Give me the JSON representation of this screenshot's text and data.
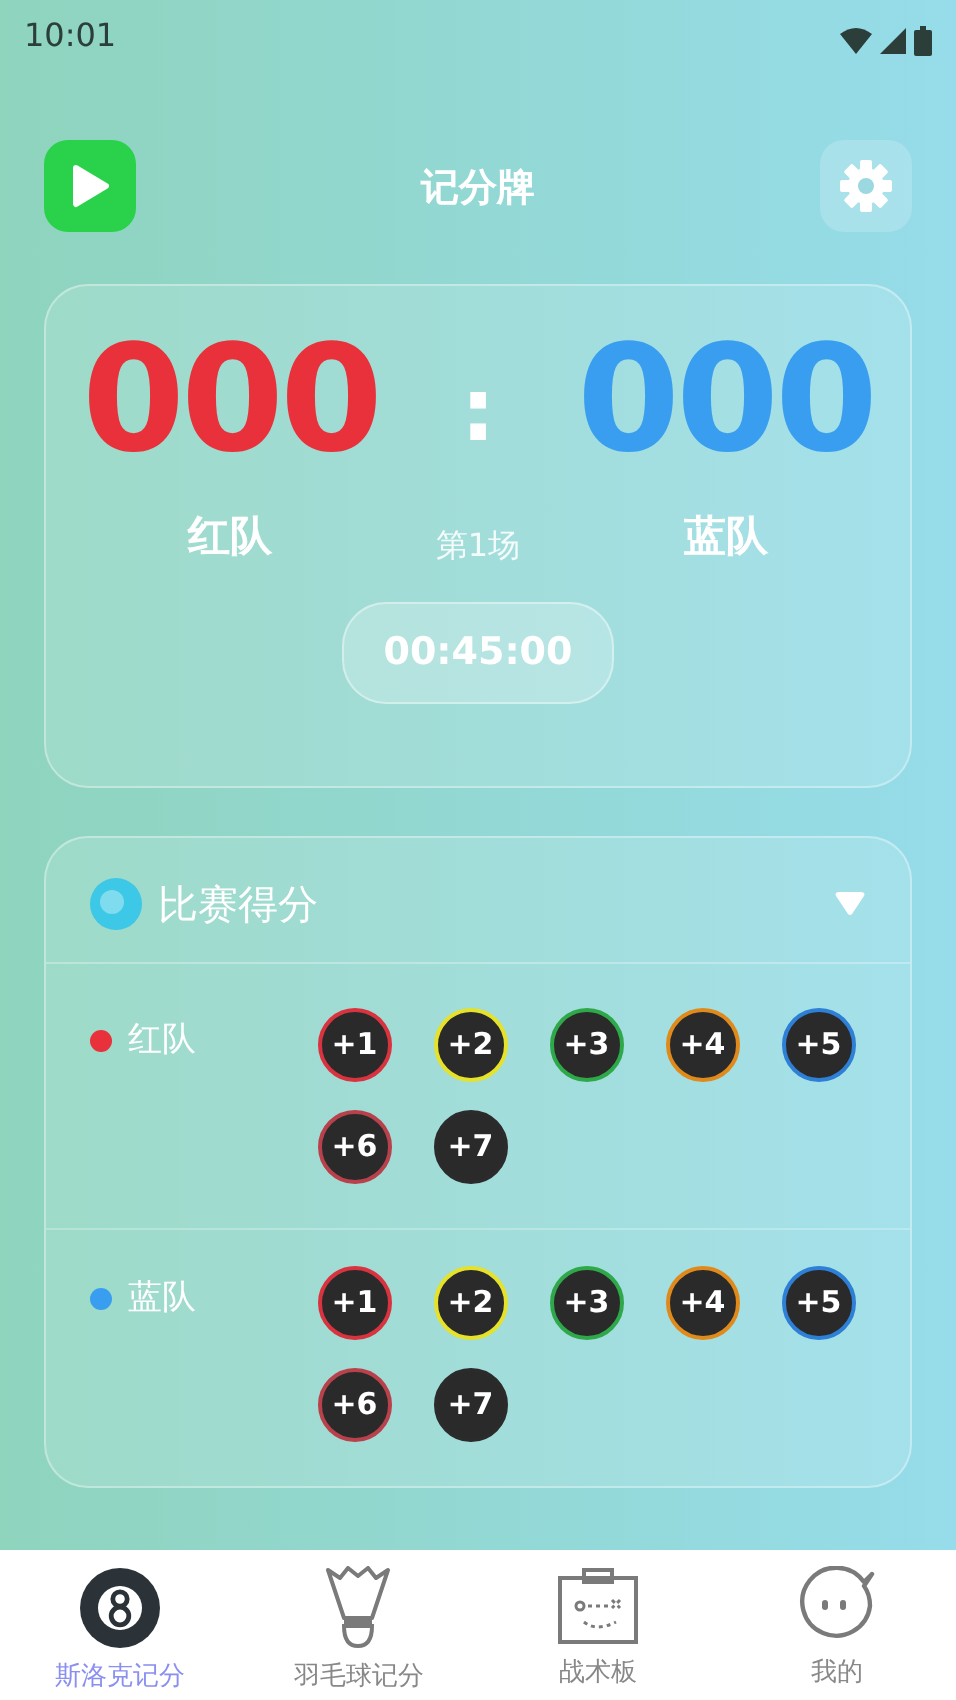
{
  "status_bar": {
    "time": "10:01"
  },
  "header": {
    "title": "记分牌"
  },
  "scoreboard": {
    "left": {
      "score": "000",
      "name": "红队",
      "color": "#e8313a"
    },
    "separator": ":",
    "right": {
      "score": "000",
      "name": "蓝队",
      "color": "#3a9ef0"
    },
    "round": "第1场",
    "timer": "00:45:00"
  },
  "scoring": {
    "title": "比赛得分",
    "expanded": true,
    "teams": [
      {
        "name": "红队",
        "color": "#e8313a",
        "buttons": [
          {
            "label": "+1",
            "color": "#d9333f"
          },
          {
            "label": "+2",
            "color": "#e6e22a"
          },
          {
            "label": "+3",
            "color": "#2fa84a"
          },
          {
            "label": "+4",
            "color": "#e08a1c"
          },
          {
            "label": "+5",
            "color": "#2e7fd6"
          },
          {
            "label": "+6",
            "color": "#b8414c"
          },
          {
            "label": "+7",
            "color": "#2b2b2b"
          }
        ]
      },
      {
        "name": "蓝队",
        "color": "#3a9ef0",
        "buttons": [
          {
            "label": "+1",
            "color": "#d9333f"
          },
          {
            "label": "+2",
            "color": "#e6e22a"
          },
          {
            "label": "+3",
            "color": "#2fa84a"
          },
          {
            "label": "+4",
            "color": "#e08a1c"
          },
          {
            "label": "+5",
            "color": "#2e7fd6"
          },
          {
            "label": "+6",
            "color": "#b8414c"
          },
          {
            "label": "+7",
            "color": "#2b2b2b"
          }
        ]
      }
    ]
  },
  "tab_bar": [
    {
      "label": "斯洛克记分",
      "kind": "ball",
      "selected": true
    },
    {
      "label": "羽毛球记分",
      "kind": "shuttle",
      "selected": false
    },
    {
      "label": "战术板",
      "kind": "board",
      "selected": false
    },
    {
      "label": "我的",
      "kind": "face",
      "selected": false
    }
  ]
}
